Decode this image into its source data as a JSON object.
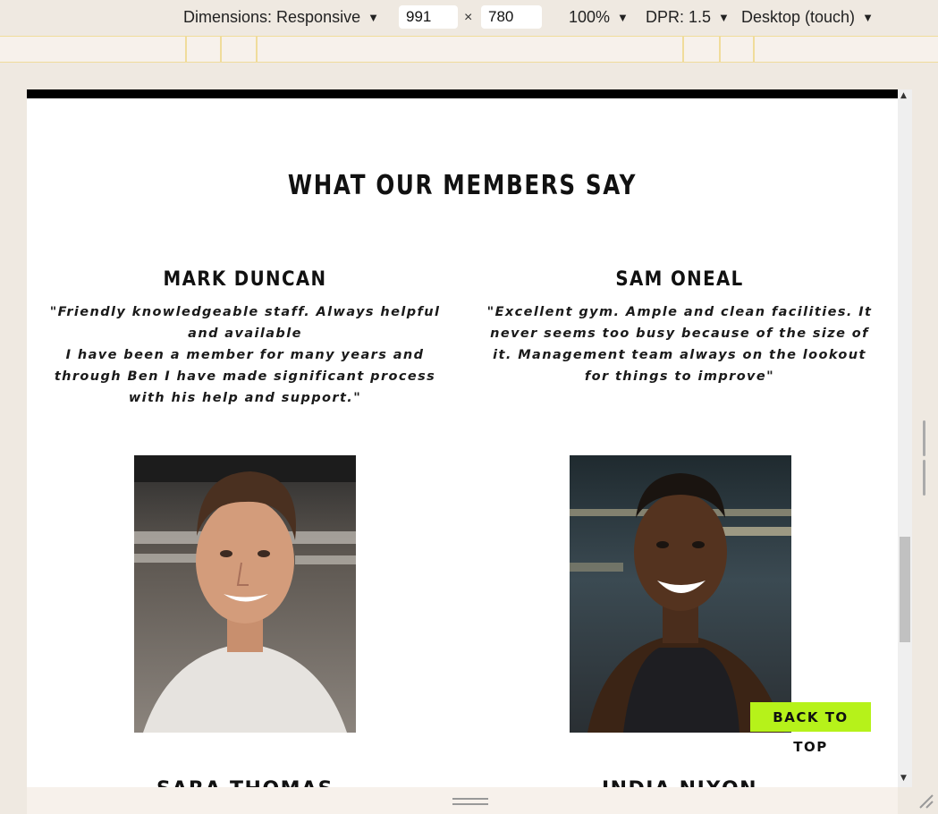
{
  "devtools": {
    "dimensions_label": "Dimensions: Responsive",
    "width_value": "991",
    "times": "×",
    "height_value": "780",
    "zoom": "100%",
    "dpr": "DPR: 1.5",
    "device_mode": "Desktop (touch)"
  },
  "page": {
    "section_title": "WHAT OUR MEMBERS SAY",
    "testimonials": [
      {
        "name": "MARK DUNCAN",
        "quote": "\"Friendly knowledgeable staff. Always helpful and available\nI have been a member for many years and through Ben I have made significant process with his help and support.\""
      },
      {
        "name": "SAM ONEAL",
        "quote": "\"Excellent gym. Ample and clean facilities. It never seems too busy because of the size of it. Management team always on the lookout for things to improve\""
      }
    ],
    "next_names": [
      "SARA THOMAS",
      "INDIA NIXON"
    ],
    "back_to_top": "BACK TO TOP"
  },
  "colors": {
    "accent": "#b6f21a",
    "text": "#111111",
    "topbar": "#000000"
  }
}
